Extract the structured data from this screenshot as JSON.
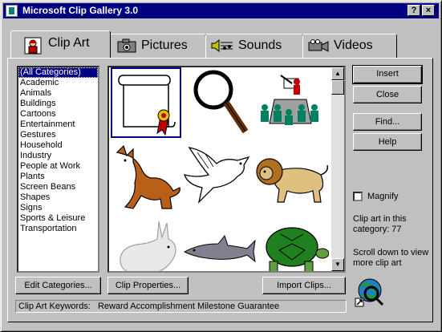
{
  "window": {
    "title": "Microsoft Clip Gallery 3.0"
  },
  "titlebar_buttons": {
    "help": "?",
    "close": "×"
  },
  "tabs": [
    {
      "label": "Clip Art",
      "active": true
    },
    {
      "label": "Pictures",
      "active": false
    },
    {
      "label": "Sounds",
      "active": false
    },
    {
      "label": "Videos",
      "active": false
    }
  ],
  "categories": {
    "items": [
      "(All Categories)",
      "Academic",
      "Animals",
      "Buildings",
      "Cartoons",
      "Entertainment",
      "Gestures",
      "Household",
      "Industry",
      "People at Work",
      "Plants",
      "Screen Beans",
      "Shapes",
      "Signs",
      "Sports & Leisure",
      "Transportation"
    ],
    "selected": "(All Categories)"
  },
  "clips": [
    "award-scroll",
    "magnifying-glass",
    "presentation-meeting",
    "donkey",
    "dove",
    "lion",
    "rabbit",
    "shark",
    "turtle"
  ],
  "buttons": {
    "insert": "Insert",
    "close": "Close",
    "find": "Find...",
    "help": "Help",
    "edit_categories": "Edit Categories...",
    "clip_properties": "Clip Properties...",
    "import_clips": "Import Clips..."
  },
  "magnify": {
    "label": "Magnify",
    "checked": false
  },
  "status": {
    "category_count": "Clip art in this category: 77",
    "scroll_hint": "Scroll down to view more clip art"
  },
  "keywords": {
    "label": "Clip Art Keywords:",
    "value": "Reward Accomplishment Milestone Guarantee"
  },
  "colors": {
    "title_bar": "#000080",
    "face": "#c0c0c0",
    "selection": "#000080"
  }
}
